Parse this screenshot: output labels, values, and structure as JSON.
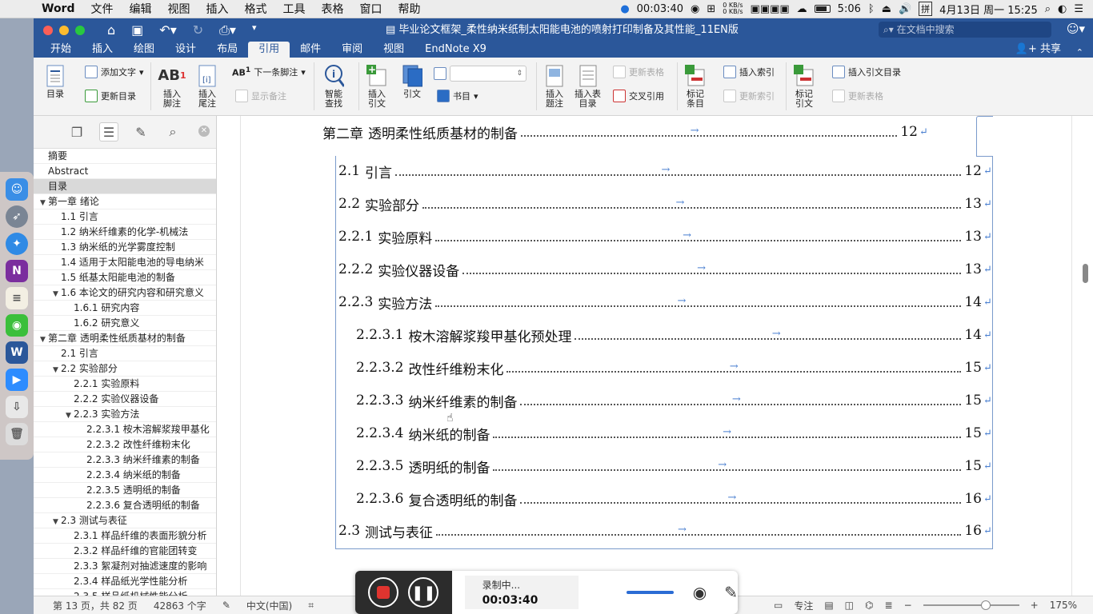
{
  "menubar": {
    "app": "Word",
    "items": [
      "文件",
      "编辑",
      "视图",
      "插入",
      "格式",
      "工具",
      "表格",
      "窗口",
      "帮助"
    ],
    "record_time": "00:03:40",
    "net_up": "0 KB/s",
    "net_down": "0 KB/s",
    "battery_time": "5:06",
    "input_method": "拼",
    "datetime": "4月13日 周一  15:25"
  },
  "window": {
    "title": "毕业论文框架_柔性纳米纸制太阳能电池的喷射打印制备及其性能_11EN版",
    "search_placeholder": "在文档中搜索",
    "share_label": "共享"
  },
  "tabs": [
    "开始",
    "插入",
    "绘图",
    "设计",
    "布局",
    "引用",
    "邮件",
    "审阅",
    "视图",
    "EndNote X9"
  ],
  "active_tab": "引用",
  "ribbon": {
    "toc": "目录",
    "add_text": "添加文字",
    "update_toc": "更新目录",
    "insert_footnote": "插入\n脚注",
    "insert_endnote": "插入\n尾注",
    "next_footnote": "下一条脚注",
    "show_notes": "显示备注",
    "smart_lookup": "智能\n查找",
    "insert_citation": "插入\n引文",
    "citations": "引文",
    "bibliography": "书目",
    "insert_caption": "插入\n题注",
    "insert_table_of_figures": "插入表\n目录",
    "update_table": "更新表格",
    "cross_reference": "交叉引用",
    "mark_entry": "标记\n条目",
    "insert_index": "插入索引",
    "update_index": "更新索引",
    "mark_citation": "标记\n引文",
    "insert_toa": "插入引文目录",
    "update_toa": "更新表格"
  },
  "nav": {
    "items": [
      {
        "label": "摘要",
        "level": 0,
        "arrow": ""
      },
      {
        "label": "Abstract",
        "level": 0,
        "arrow": ""
      },
      {
        "label": "目录",
        "level": 0,
        "arrow": "",
        "selected": true
      },
      {
        "label": "第一章 绪论",
        "level": 0,
        "arrow": "▼"
      },
      {
        "label": "1.1 引言",
        "level": 1,
        "arrow": ""
      },
      {
        "label": "1.2 纳米纤维素的化学-机械法",
        "level": 1,
        "arrow": ""
      },
      {
        "label": "1.3 纳米纸的光学雾度控制",
        "level": 1,
        "arrow": ""
      },
      {
        "label": "1.4 适用于太阳能电池的导电纳米",
        "level": 1,
        "arrow": ""
      },
      {
        "label": "1.5 纸基太阳能电池的制备",
        "level": 1,
        "arrow": ""
      },
      {
        "label": "1.6 本论文的研究内容和研究意义",
        "level": 1,
        "arrow": "▼"
      },
      {
        "label": "1.6.1 研究内容",
        "level": 2,
        "arrow": ""
      },
      {
        "label": "1.6.2 研究意义",
        "level": 2,
        "arrow": ""
      },
      {
        "label": "第二章 透明柔性纸质基材的制备",
        "level": 0,
        "arrow": "▼"
      },
      {
        "label": "2.1 引言",
        "level": 1,
        "arrow": ""
      },
      {
        "label": "2.2 实验部分",
        "level": 1,
        "arrow": "▼"
      },
      {
        "label": "2.2.1 实验原料",
        "level": 2,
        "arrow": ""
      },
      {
        "label": "2.2.2 实验仪器设备",
        "level": 2,
        "arrow": ""
      },
      {
        "label": "2.2.3 实验方法",
        "level": 2,
        "arrow": "▼"
      },
      {
        "label": "2.2.3.1 桉木溶解浆羧甲基化",
        "level": 3,
        "arrow": ""
      },
      {
        "label": "2.2.3.2 改性纤维粉末化",
        "level": 3,
        "arrow": ""
      },
      {
        "label": "2.2.3.3 纳米纤维素的制备",
        "level": 3,
        "arrow": ""
      },
      {
        "label": "2.2.3.4 纳米纸的制备",
        "level": 3,
        "arrow": ""
      },
      {
        "label": "2.2.3.5 透明纸的制备",
        "level": 3,
        "arrow": ""
      },
      {
        "label": "2.2.3.6 复合透明纸的制备",
        "level": 3,
        "arrow": ""
      },
      {
        "label": "2.3 测试与表征",
        "level": 1,
        "arrow": "▼"
      },
      {
        "label": "2.3.1 样品纤维的表面形貌分析",
        "level": 2,
        "arrow": ""
      },
      {
        "label": "2.3.2 样品纤维的官能团转变",
        "level": 2,
        "arrow": ""
      },
      {
        "label": "2.3.3 絮凝剂对抽滤速度的影响",
        "level": 2,
        "arrow": ""
      },
      {
        "label": "2.3.4 样品纸光学性能分析",
        "level": 2,
        "arrow": ""
      },
      {
        "label": "2.3.5 样品纸机械性能分析",
        "level": 2,
        "arrow": ""
      }
    ]
  },
  "toc": [
    {
      "num": "第二章",
      "text": "透明柔性纸质基材的制备",
      "page": "12",
      "level": 0
    },
    {
      "num": "2.1",
      "text": "引言",
      "page": "12",
      "level": 1
    },
    {
      "num": "2.2",
      "text": "实验部分",
      "page": "13",
      "level": 1
    },
    {
      "num": "2.2.1",
      "text": "实验原料",
      "page": "13",
      "level": 2
    },
    {
      "num": "2.2.2",
      "text": "实验仪器设备",
      "page": "13",
      "level": 2
    },
    {
      "num": "2.2.3",
      "text": "实验方法",
      "page": "14",
      "level": 2
    },
    {
      "num": "2.2.3.1",
      "text": "桉木溶解浆羧甲基化预处理",
      "page": "14",
      "level": 3
    },
    {
      "num": "2.2.3.2",
      "text": "改性纤维粉末化",
      "page": "15",
      "level": 3
    },
    {
      "num": "2.2.3.3",
      "text": "纳米纤维素的制备",
      "page": "15",
      "level": 3
    },
    {
      "num": "2.2.3.4",
      "text": "纳米纸的制备",
      "page": "15",
      "level": 3
    },
    {
      "num": "2.2.3.5",
      "text": "透明纸的制备",
      "page": "15",
      "level": 3
    },
    {
      "num": "2.2.3.6",
      "text": "复合透明纸的制备",
      "page": "16",
      "level": 3
    },
    {
      "num": "2.3",
      "text": "测试与表征",
      "page": "16",
      "level": 1
    }
  ],
  "status": {
    "page": "第 13 页，共 82 页",
    "words": "42863 个字",
    "language": "中文(中国)",
    "focus": "专注",
    "zoom": "175%"
  },
  "recorder": {
    "status": "录制中...",
    "time": "00:03:40"
  },
  "colors": {
    "word_blue": "#2b579a",
    "toc_border": "#7a9acb",
    "record_red": "#e0342f"
  }
}
